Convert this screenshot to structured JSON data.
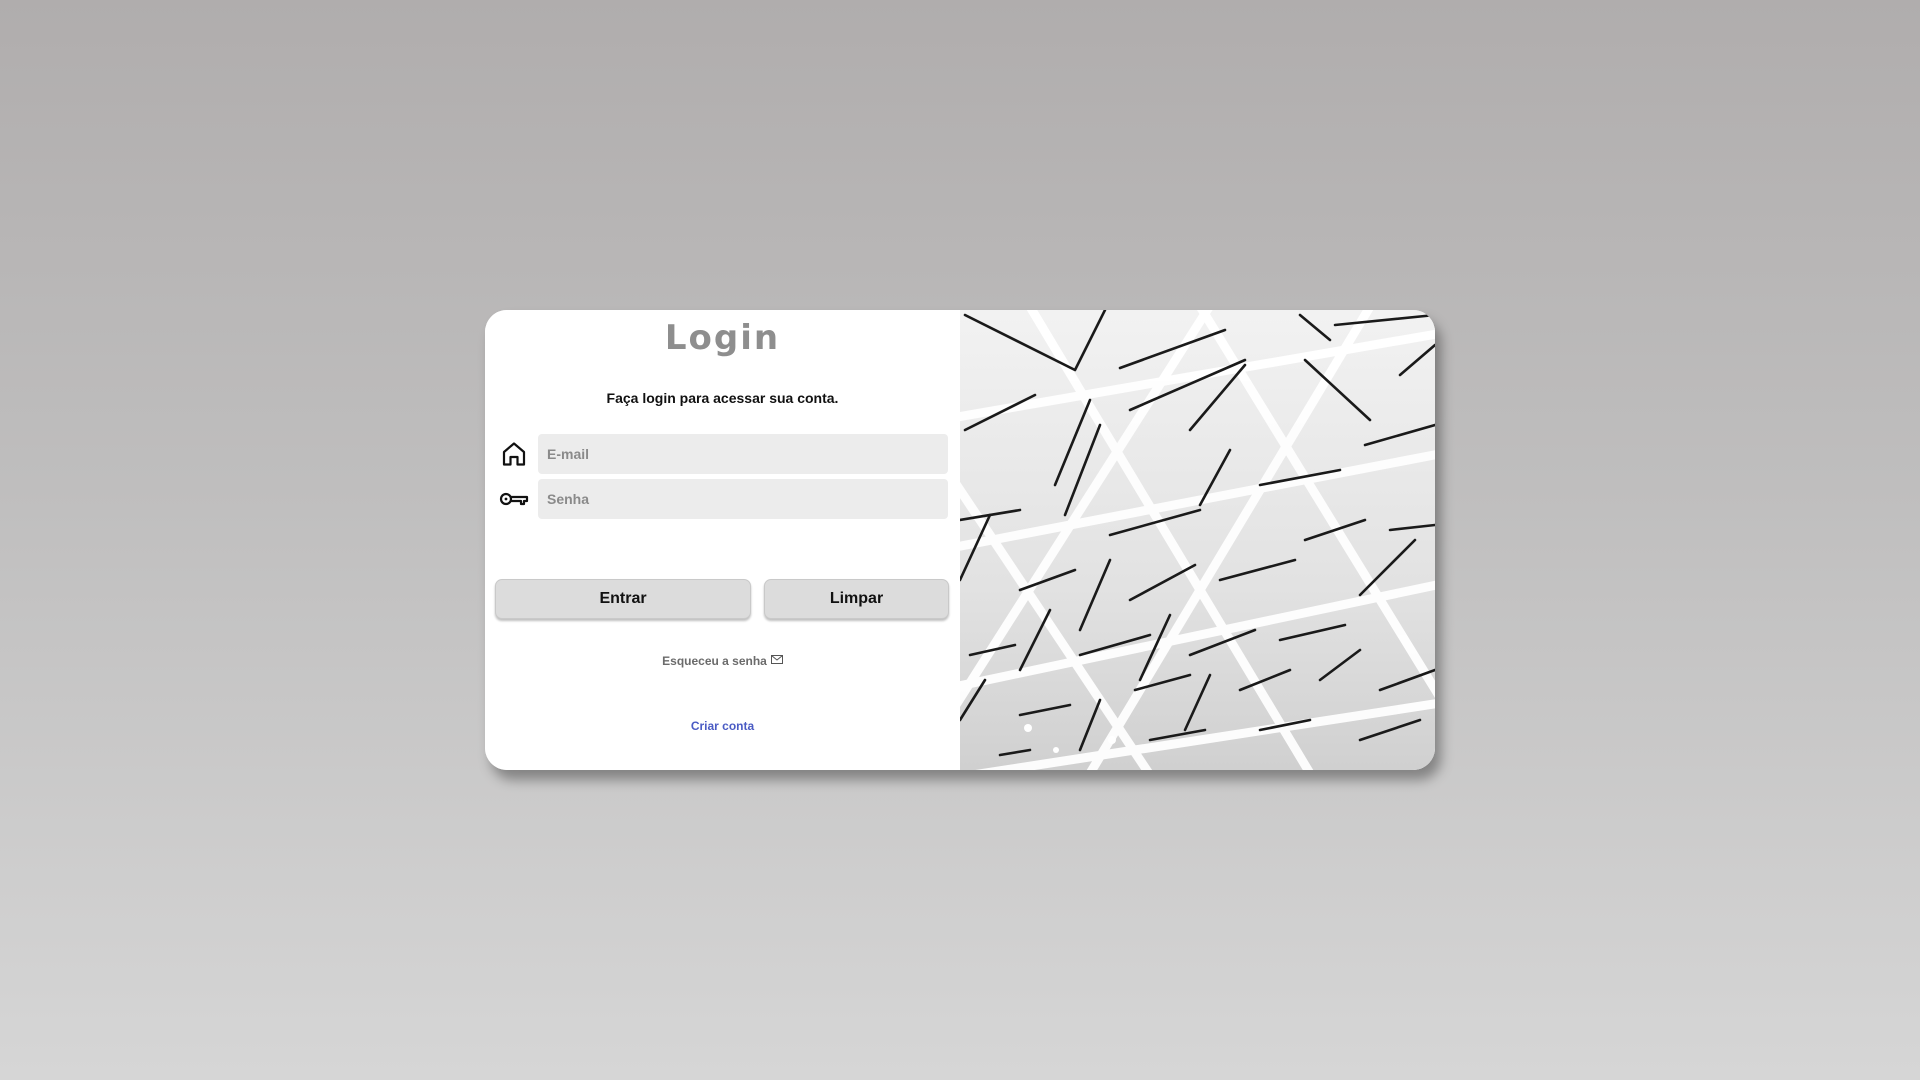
{
  "login": {
    "title": "Login",
    "subtitle": "Faça login para acessar sua conta.",
    "email_placeholder": "E-mail",
    "password_placeholder": "Senha",
    "enter_label": "Entrar",
    "clear_label": "Limpar",
    "forgot_label": "Esqueceu a senha",
    "create_label": "Criar conta"
  },
  "icons": {
    "email": "home-icon",
    "password": "key-icon",
    "forgot": "mail-icon"
  },
  "colors": {
    "title": "#8e8e8e",
    "link": "#4a5bc4",
    "button": "#dcdcdc",
    "field": "#ececec"
  }
}
